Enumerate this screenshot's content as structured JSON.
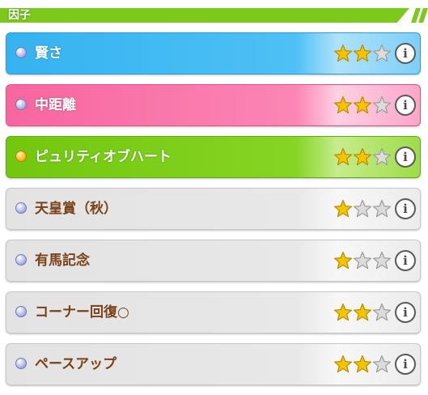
{
  "header": {
    "title": "因子"
  },
  "factors": [
    {
      "name": "賢さ",
      "stars": 2,
      "max_stars": 3,
      "style": "blue"
    },
    {
      "name": "中距離",
      "stars": 2,
      "max_stars": 3,
      "style": "pink"
    },
    {
      "name": "ピュリティオブハート",
      "stars": 2,
      "max_stars": 3,
      "style": "green"
    },
    {
      "name": "天皇賞（秋）",
      "stars": 1,
      "max_stars": 3,
      "style": "gray"
    },
    {
      "name": "有馬記念",
      "stars": 1,
      "max_stars": 3,
      "style": "gray"
    },
    {
      "name": "コーナー回復○",
      "stars": 2,
      "max_stars": 3,
      "style": "gray"
    },
    {
      "name": "ペースアップ",
      "stars": 2,
      "max_stars": 3,
      "style": "gray"
    }
  ],
  "info_label": "i",
  "colors": {
    "header_green": "#7cc81c",
    "blue": "#35b3f0",
    "pink": "#f7669e",
    "green": "#72c80e",
    "gray": "#e3e3e3",
    "star_gold": "#f5c400",
    "star_empty": "#dcdcdc",
    "label_brown": "#7a4218"
  },
  "icons": {
    "bullet": "orb-icon",
    "star": "star-icon",
    "info": "info-icon"
  }
}
